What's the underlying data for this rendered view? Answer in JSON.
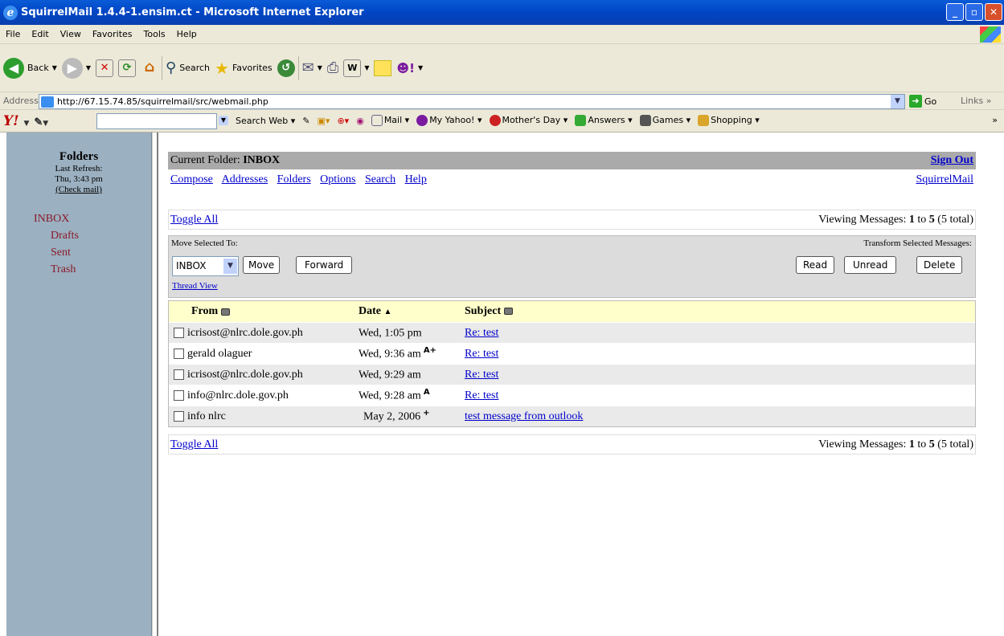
{
  "window": {
    "title": "SquirrelMail 1.4.4-1.ensim.ct - Microsoft Internet Explorer",
    "controls": [
      "_",
      "▫",
      "✕"
    ]
  },
  "menu": [
    "File",
    "Edit",
    "View",
    "Favorites",
    "Tools",
    "Help"
  ],
  "toolbar": {
    "back": "Back",
    "search": "Search",
    "favorites": "Favorites"
  },
  "address": {
    "label": "Address",
    "url": "http://67.15.74.85/squirrelmail/src/webmail.php",
    "go": "Go",
    "links": "Links"
  },
  "yahoo": {
    "search_web": "Search Web",
    "items": [
      "Mail",
      "My Yahoo!",
      "Mother's Day",
      "Answers",
      "Games",
      "Shopping"
    ]
  },
  "left": {
    "heading": "Folders",
    "last_refresh_label": "Last Refresh:",
    "last_refresh_time": "Thu, 3:43 pm",
    "check_mail": "(Check mail)",
    "folders": [
      "INBOX",
      "Drafts",
      "Sent",
      "Trash"
    ]
  },
  "main": {
    "current_folder_label": "Current Folder: ",
    "current_folder": "INBOX",
    "sign_out": "Sign Out",
    "nav": [
      "Compose",
      "Addresses",
      "Folders",
      "Options",
      "Search",
      "Help"
    ],
    "squirrelmail_link": "SquirrelMail",
    "toggle_all": "Toggle All",
    "viewing_prefix": "Viewing Messages: ",
    "viewing_from": "1",
    "viewing_to_word": " to ",
    "viewing_to": "5",
    "viewing_total": " (5 total)",
    "move_selected_to": "Move Selected To:",
    "transform_selected": "Transform Selected Messages:",
    "folder_select_value": "INBOX",
    "move_button": "Move",
    "forward_button": "Forward",
    "read_button": "Read",
    "unread_button": "Unread",
    "delete_button": "Delete",
    "thread_view": "Thread View",
    "columns": {
      "from": "From",
      "date": "Date",
      "subject": "Subject"
    },
    "messages": [
      {
        "from": "icrisost@nlrc.dole.gov.ph",
        "date": "Wed, 1:05 pm",
        "flag": "",
        "subject": "Re: test"
      },
      {
        "from": "gerald olaguer",
        "date": "Wed, 9:36 am",
        "flag": "A+",
        "subject": "Re: test"
      },
      {
        "from": "icrisost@nlrc.dole.gov.ph",
        "date": "Wed, 9:29 am",
        "flag": "",
        "subject": "Re: test"
      },
      {
        "from": "info@nlrc.dole.gov.ph",
        "date": "Wed, 9:28 am",
        "flag": "A",
        "subject": "Re: test"
      },
      {
        "from": "info nlrc",
        "date": "May 2, 2006",
        "flag": "+",
        "subject": "test message from outlook"
      }
    ]
  }
}
